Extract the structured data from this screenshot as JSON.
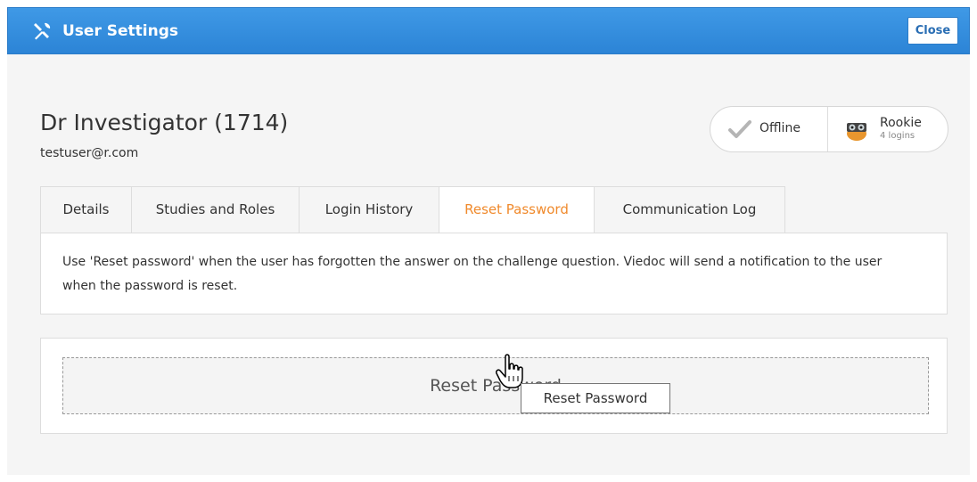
{
  "header": {
    "title": "User Settings",
    "icon": "tools-icon",
    "close_label": "Close",
    "color": "#3390e0"
  },
  "user": {
    "name": "Dr Investigator (1714)",
    "email": "testuser@r.com"
  },
  "status": {
    "presence_label": "Offline",
    "presence_icon": "check-icon",
    "rank_label": "Rookie",
    "rank_sub": "4 logins",
    "rank_icon": "rookie-icon"
  },
  "tabs": [
    {
      "label": "Details",
      "active": false
    },
    {
      "label": "Studies and Roles",
      "active": false
    },
    {
      "label": "Login History",
      "active": false
    },
    {
      "label": "Reset Password",
      "active": true
    },
    {
      "label": "Communication Log",
      "active": false
    }
  ],
  "info": {
    "text": "Use 'Reset password' when the user has forgotten the answer on the challenge question. Viedoc will send a notification to the user when the password is reset."
  },
  "reset": {
    "button_label": "Reset Password",
    "tooltip": "Reset Password"
  },
  "colors": {
    "active_tab": "#f08a2c",
    "panel_bg": "#f5f5f5"
  }
}
